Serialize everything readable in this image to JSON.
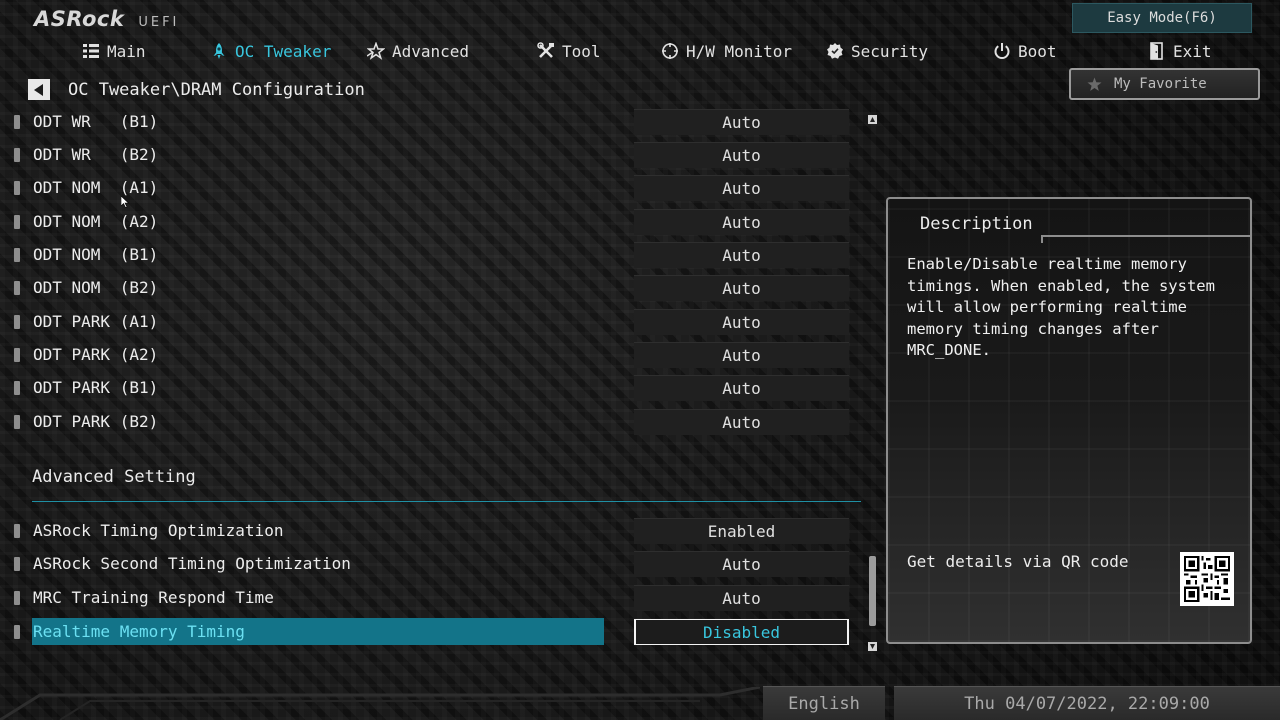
{
  "header": {
    "brand": "ASRock",
    "product": "UEFI",
    "easy_mode": "Easy Mode(F6)"
  },
  "nav": {
    "items": [
      {
        "label": "Main",
        "icon": "list-icon"
      },
      {
        "label": "OC Tweaker",
        "icon": "rocket-icon",
        "active": true
      },
      {
        "label": "Advanced",
        "icon": "star-icon"
      },
      {
        "label": "Tool",
        "icon": "tools-icon"
      },
      {
        "label": "H/W Monitor",
        "icon": "monitor-target-icon"
      },
      {
        "label": "Security",
        "icon": "shield-badge-icon"
      },
      {
        "label": "Boot",
        "icon": "power-icon"
      },
      {
        "label": "Exit",
        "icon": "door-exit-icon"
      }
    ]
  },
  "breadcrumb": "OC Tweaker\\DRAM Configuration",
  "favorite": {
    "label": "My Favorite",
    "icon": "star-icon"
  },
  "settings": [
    {
      "label": "ODT WR   (B1)",
      "value": "Auto"
    },
    {
      "label": "ODT WR   (B2)",
      "value": "Auto"
    },
    {
      "label": "ODT NOM  (A1)",
      "value": "Auto"
    },
    {
      "label": "ODT NOM  (A2)",
      "value": "Auto"
    },
    {
      "label": "ODT NOM  (B1)",
      "value": "Auto"
    },
    {
      "label": "ODT NOM  (B2)",
      "value": "Auto"
    },
    {
      "label": "ODT PARK (A1)",
      "value": "Auto"
    },
    {
      "label": "ODT PARK (A2)",
      "value": "Auto"
    },
    {
      "label": "ODT PARK (B1)",
      "value": "Auto"
    },
    {
      "label": "ODT PARK (B2)",
      "value": "Auto"
    }
  ],
  "advanced_section": {
    "title": "Advanced Setting",
    "settings": [
      {
        "label": "ASRock Timing Optimization",
        "value": "Enabled"
      },
      {
        "label": "ASRock Second Timing Optimization",
        "value": "Auto"
      },
      {
        "label": "MRC Training Respond Time",
        "value": "Auto"
      },
      {
        "label": "Realtime Memory Timing",
        "value": "Disabled",
        "selected": true
      }
    ]
  },
  "description": {
    "title": "Description",
    "text": "Enable/Disable realtime memory timings. When enabled, the system will allow performing realtime memory timing changes after MRC_DONE.",
    "qr_label": "Get details via QR code"
  },
  "footer": {
    "language": "English",
    "datetime": "Thu 04/07/2022, 22:09:00"
  },
  "colors": {
    "accent": "#39c6de",
    "selected_row": "#137489"
  }
}
